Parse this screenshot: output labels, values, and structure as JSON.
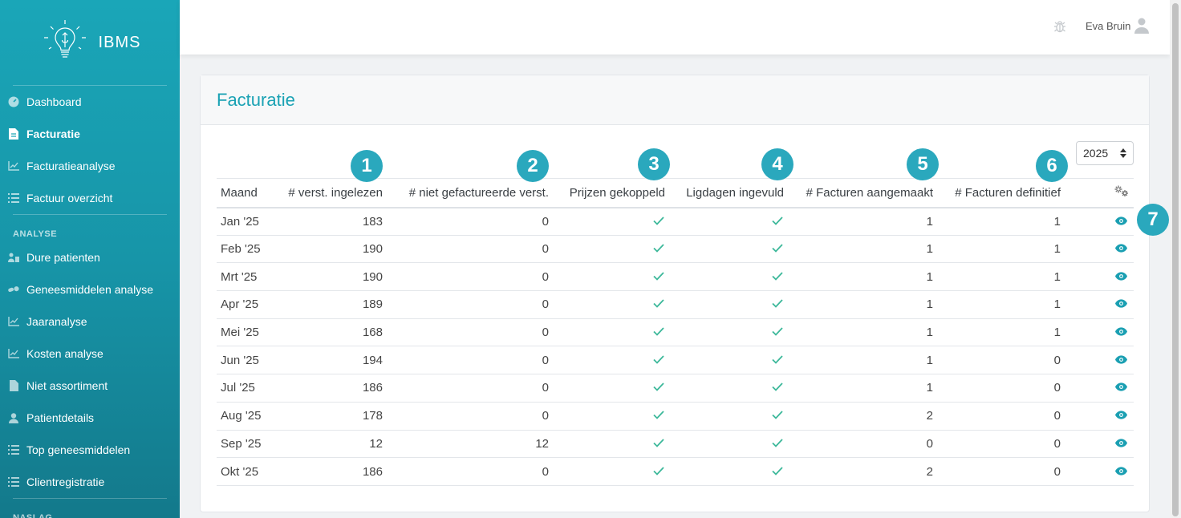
{
  "sidebar": {
    "brand": "IBMS",
    "items": [
      {
        "label": "Dashboard",
        "icon": "dashboard-icon"
      },
      {
        "label": "Facturatie",
        "icon": "invoice-icon",
        "active": true
      },
      {
        "label": "Facturatieanalyse",
        "icon": "chart-icon"
      },
      {
        "label": "Factuur overzicht",
        "icon": "list-icon"
      }
    ],
    "analyse_label": "ANALYSE",
    "analyse_items": [
      {
        "label": "Dure patienten",
        "icon": "patients-icon"
      },
      {
        "label": "Geneesmiddelen analyse",
        "icon": "pills-icon"
      },
      {
        "label": "Jaaranalyse",
        "icon": "chart-icon"
      },
      {
        "label": "Kosten analyse",
        "icon": "chart-icon"
      },
      {
        "label": "Niet assortiment",
        "icon": "file-icon"
      },
      {
        "label": "Patientdetails",
        "icon": "user-icon"
      },
      {
        "label": "Top geneesmiddelen",
        "icon": "list-icon"
      },
      {
        "label": "Clientregistratie",
        "icon": "list-icon"
      }
    ],
    "naslag_label": "NASLAG"
  },
  "topbar": {
    "user_name": "Eva Bruin"
  },
  "card": {
    "title": "Facturatie",
    "year": "2025"
  },
  "table": {
    "headers": [
      "Maand",
      "# verst. ingelezen",
      "# niet gefactureerde verst.",
      "Prijzen gekoppeld",
      "Ligdagen ingevuld",
      "# Facturen aangemaakt",
      "# Facturen definitief"
    ],
    "rows": [
      {
        "maand": "Jan '25",
        "ingelezen": "183",
        "niet_gefact": "0",
        "aangemaakt": "1",
        "definitief": "1"
      },
      {
        "maand": "Feb '25",
        "ingelezen": "190",
        "niet_gefact": "0",
        "aangemaakt": "1",
        "definitief": "1"
      },
      {
        "maand": "Mrt '25",
        "ingelezen": "190",
        "niet_gefact": "0",
        "aangemaakt": "1",
        "definitief": "1"
      },
      {
        "maand": "Apr '25",
        "ingelezen": "189",
        "niet_gefact": "0",
        "aangemaakt": "1",
        "definitief": "1"
      },
      {
        "maand": "Mei '25",
        "ingelezen": "168",
        "niet_gefact": "0",
        "aangemaakt": "1",
        "definitief": "1"
      },
      {
        "maand": "Jun '25",
        "ingelezen": "194",
        "niet_gefact": "0",
        "aangemaakt": "1",
        "definitief": "0"
      },
      {
        "maand": "Jul '25",
        "ingelezen": "186",
        "niet_gefact": "0",
        "aangemaakt": "1",
        "definitief": "0"
      },
      {
        "maand": "Aug '25",
        "ingelezen": "178",
        "niet_gefact": "0",
        "aangemaakt": "2",
        "definitief": "0"
      },
      {
        "maand": "Sep '25",
        "ingelezen": "12",
        "niet_gefact": "12",
        "aangemaakt": "0",
        "definitief": "0"
      },
      {
        "maand": "Okt '25",
        "ingelezen": "186",
        "niet_gefact": "0",
        "aangemaakt": "2",
        "definitief": "0"
      }
    ]
  },
  "badges": [
    "1",
    "2",
    "3",
    "4",
    "5",
    "6",
    "7"
  ],
  "colors": {
    "accent": "#1aa2b4",
    "badge": "#2aa8bd",
    "check": "#3cb89a",
    "eye": "#1a9fb2"
  }
}
